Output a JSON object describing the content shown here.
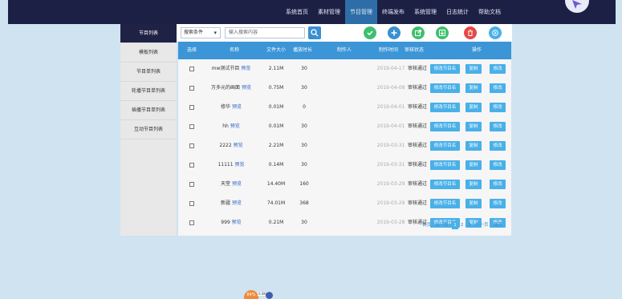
{
  "nav": {
    "items": [
      "系统首页",
      "素材管理",
      "节目管理",
      "终端发布",
      "系统管理",
      "日志统计",
      "帮助文档"
    ],
    "active": 2
  },
  "sidebar": {
    "items": [
      "节目列表",
      "模板列表",
      "节目单列表",
      "轮播节目单列表",
      "插播节目单列表",
      "互动节目列表"
    ],
    "active": 0
  },
  "toolbar": {
    "select_value": "搜索条件",
    "search_placeholder": "输入搜索内容",
    "icons": [
      {
        "name": "check-icon",
        "color": "#3fbf6e"
      },
      {
        "name": "add-icon",
        "color": "#3b8fd0"
      },
      {
        "name": "export-icon",
        "color": "#3fbf6e"
      },
      {
        "name": "import-icon",
        "color": "#3fbf6e"
      },
      {
        "name": "delete-icon",
        "color": "#e84747"
      },
      {
        "name": "refresh-icon",
        "color": "#49b0e8"
      }
    ]
  },
  "table": {
    "headers": {
      "select": "选择",
      "name": "名称",
      "size": "文件大小",
      "duration": "播放时长",
      "author": "制作人",
      "time": "制作时间",
      "status": "审核状态",
      "ops": "操作"
    },
    "preview_label": "预览",
    "btn_edit_name": "修改节目名",
    "btn_copy": "复制",
    "btn_modify": "修改",
    "rows": [
      {
        "name": "mw测试节目",
        "size": "2.11M",
        "duration": "30",
        "author": "",
        "date": "2019-04-17",
        "status": "审核通过"
      },
      {
        "name": "万多元的画面",
        "size": "0.75M",
        "duration": "30",
        "author": "",
        "date": "2019-04-08",
        "status": "审核通过"
      },
      {
        "name": "修华",
        "size": "0.01M",
        "duration": "0",
        "author": "",
        "date": "2019-04-01",
        "status": "审核通过"
      },
      {
        "name": "hh",
        "size": "0.01M",
        "duration": "30",
        "author": "",
        "date": "2019-04-01",
        "status": "审核通过"
      },
      {
        "name": "2222",
        "size": "2.21M",
        "duration": "30",
        "author": "",
        "date": "2019-03-31",
        "status": "审核通过"
      },
      {
        "name": "11111",
        "size": "0.14M",
        "duration": "30",
        "author": "",
        "date": "2019-03-31",
        "status": "审核通过"
      },
      {
        "name": "天堂",
        "size": "14.40M",
        "duration": "160",
        "author": "",
        "date": "2019-03-29",
        "status": "审核通过"
      },
      {
        "name": "新疆",
        "size": "74.01M",
        "duration": "368",
        "author": "",
        "date": "2019-03-29",
        "status": "审核通过"
      },
      {
        "name": "999",
        "size": "0.21M",
        "duration": "30",
        "author": "",
        "date": "2019-03-28",
        "status": "审核通过"
      }
    ]
  },
  "pager": {
    "first": "首页",
    "prev": "上一页",
    "pages": [
      "1",
      "2",
      "3"
    ],
    "current": "1",
    "next": "下一页",
    "last": "尾页"
  },
  "monitor": {
    "percent": "84%",
    "speed": "0.0Kb/s"
  }
}
